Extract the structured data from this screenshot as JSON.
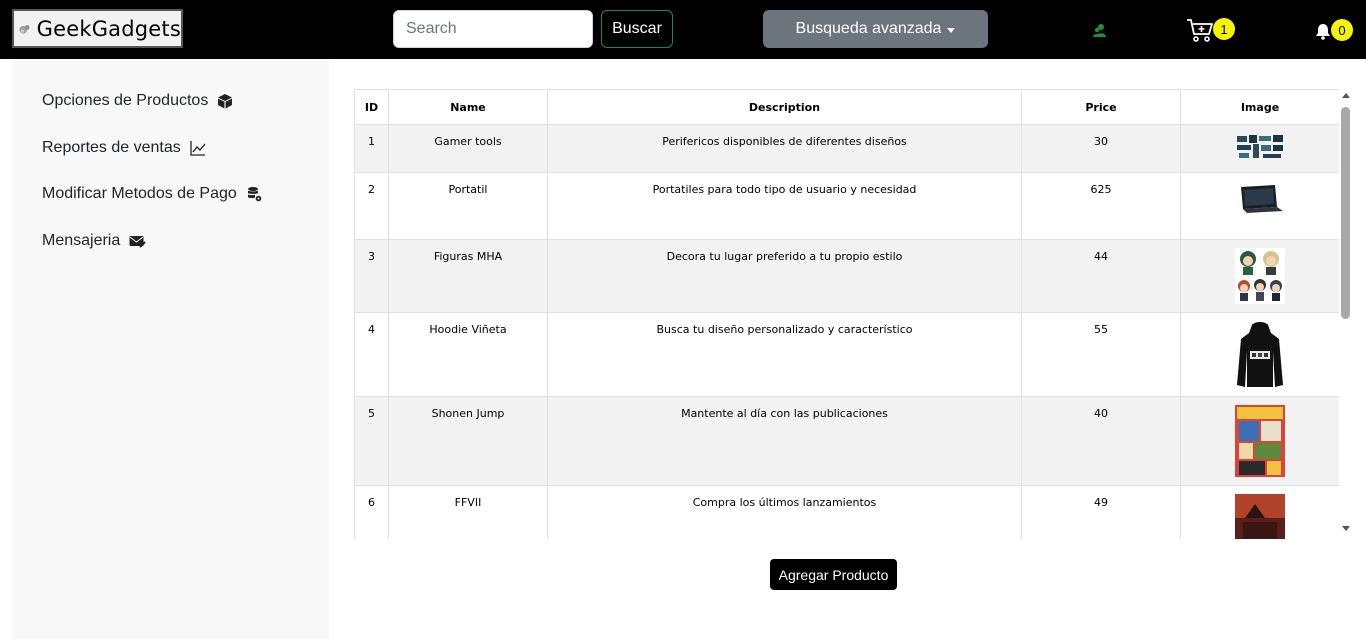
{
  "brand": {
    "name": "GeekGadgets",
    "logo_icon": "logo-icon"
  },
  "search": {
    "placeholder": "Search",
    "value": "",
    "button_label": "Buscar"
  },
  "advanced_search": {
    "label": "Busqueda avanzada"
  },
  "cart": {
    "count": "1"
  },
  "notifications": {
    "count": "0"
  },
  "colors": {
    "navbar": "#000000",
    "badge": "#f5f500",
    "buscar_border": "#198754",
    "advanced_bg": "#6c757d",
    "sidebar_bg": "#f8f8f8",
    "row_striped": "#f2f2f2"
  },
  "sidebar": {
    "items": [
      {
        "label": "Opciones de Productos",
        "icon": "box-icon"
      },
      {
        "label": "Reportes de ventas",
        "icon": "chart-line-icon"
      },
      {
        "label": "Modificar Metodos de Pago",
        "icon": "database-gear-icon"
      },
      {
        "label": "Mensajeria",
        "icon": "envelope-icon"
      }
    ]
  },
  "table": {
    "headers": {
      "id": "ID",
      "name": "Name",
      "description": "Description",
      "price": "Price",
      "image": "Image"
    },
    "rows": [
      {
        "id": "1",
        "name": "Gamer tools",
        "description": "Perifericos disponibles de diferentes diseños",
        "price": "30"
      },
      {
        "id": "2",
        "name": "Portatil",
        "description": "Portatiles para todo tipo de usuario y necesidad",
        "price": "625"
      },
      {
        "id": "3",
        "name": "Figuras MHA",
        "description": "Decora tu lugar preferido a tu propio estilo",
        "price": "44"
      },
      {
        "id": "4",
        "name": "Hoodie Viñeta",
        "description": "Busca tu diseño personalizado y característico",
        "price": "55"
      },
      {
        "id": "5",
        "name": "Shonen Jump",
        "description": "Mantente al día con las publicaciones",
        "price": "40"
      },
      {
        "id": "6",
        "name": "FFVII",
        "description": "Compra los últimos lanzamientos",
        "price": "49"
      }
    ]
  },
  "add_button": {
    "label": "Agregar Producto"
  }
}
